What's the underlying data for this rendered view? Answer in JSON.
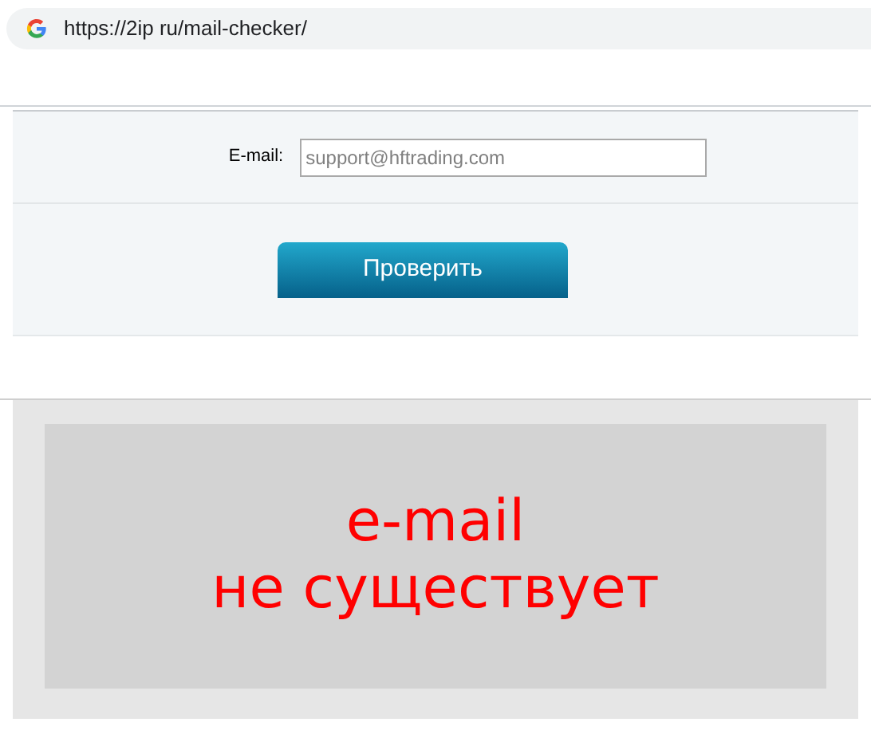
{
  "address_bar": {
    "url": "https://2ip ru/mail-checker/"
  },
  "form": {
    "email_label": "E-mail:",
    "email_value": "support@hftrading.com",
    "button": "Проверить"
  },
  "result": {
    "lines": [
      "e-mail",
      "не существует"
    ]
  }
}
